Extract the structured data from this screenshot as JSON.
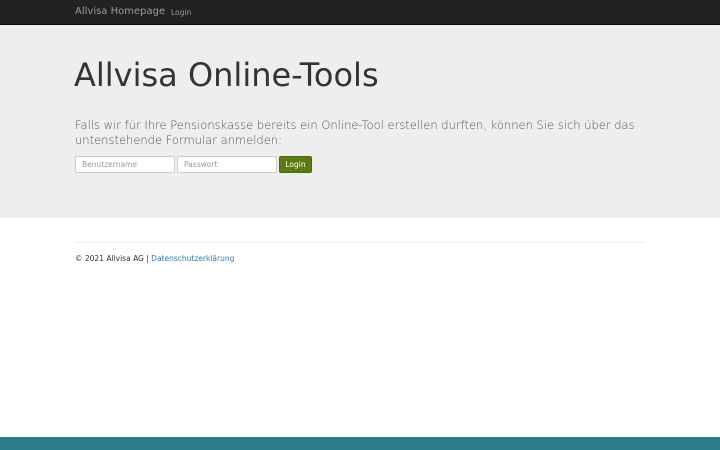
{
  "navbar": {
    "brand": "Allvisa Homepage",
    "login_link": "Login"
  },
  "jumbotron": {
    "title": "Allvisa Online-Tools",
    "lead": "Falls wir für Ihre Pensionskasse bereits ein Online-Tool erstellen durften, können Sie sich über das untenstehende Formular anmelden:"
  },
  "form": {
    "username_placeholder": "Benutzername",
    "username_value": "",
    "password_placeholder": "Passwort",
    "password_value": "",
    "submit_label": "Login"
  },
  "footer": {
    "copyright": "© 2021 Allvisa AG | ",
    "privacy_link": "Datenschutzerklärung"
  },
  "colors": {
    "navbar_bg": "#222222",
    "jumbotron_bg": "#eeeeee",
    "button_bg": "#5a7b12",
    "link": "#337ab7",
    "bottom_bar": "#2e7d8c"
  }
}
